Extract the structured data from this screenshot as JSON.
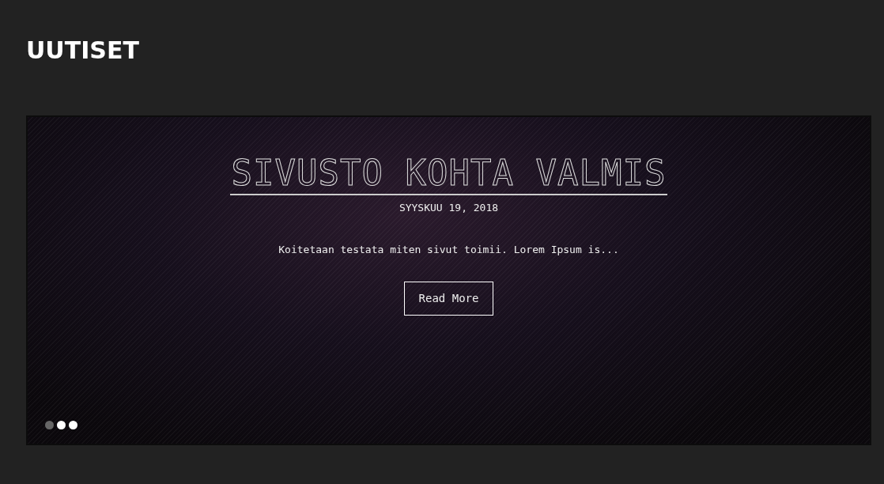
{
  "page_title": "UUTISET",
  "slide": {
    "title": "SIVUSTO KOHTA VALMIS",
    "date": "SYYSKUU 19, 2018",
    "excerpt": "Koitetaan testata miten sivut toimii. Lorem Ipsum is...",
    "button": "Read More"
  },
  "dots": [
    {
      "selected": true
    },
    {
      "selected": false
    },
    {
      "selected": false
    }
  ]
}
